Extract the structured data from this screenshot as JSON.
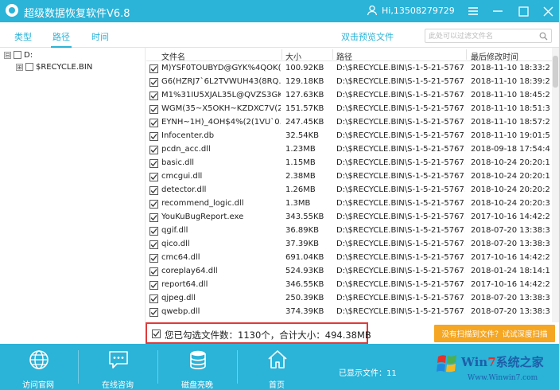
{
  "window": {
    "title": "超级数据恢复软件V6.8",
    "user": "Hi,13508279729",
    "accent_color": "#2bb3d8"
  },
  "toolbar": {
    "tabs": [
      {
        "label": "类型"
      },
      {
        "label": "路径"
      },
      {
        "label": "时间"
      }
    ],
    "active_tab": "路径",
    "preview_label": "双击预览文件",
    "search_placeholder": "此处可以过滤文件名"
  },
  "tree": {
    "items": [
      {
        "toggle": "⊟",
        "label": "D:"
      },
      {
        "toggle": "⊞",
        "label": "$RECYCLE.BIN"
      }
    ]
  },
  "table": {
    "columns": [
      "文件名",
      "大小",
      "路径",
      "最后修改时间"
    ],
    "rows": [
      {
        "name": "M)YSF0TOUBYD@GYK%4QOK(...",
        "size": "100.92KB",
        "path": "D:\\$RECYCLE.BIN\\S-1-5-21-5767...",
        "time": "2018-11-10 18:33:22"
      },
      {
        "name": "G6(HZRJ7`6L2TVWUH43(8RQ.j...",
        "size": "129.18KB",
        "path": "D:\\$RECYCLE.BIN\\S-1-5-21-5767...",
        "time": "2018-11-10 18:39:22"
      },
      {
        "name": "M1%31IU5XJAL35L@QVZS3GK...",
        "size": "127.63KB",
        "path": "D:\\$RECYCLE.BIN\\S-1-5-21-5767...",
        "time": "2018-11-10 18:45:22"
      },
      {
        "name": "WGM(35~X5OKH~KZDXC7V(2...",
        "size": "151.57KB",
        "path": "D:\\$RECYCLE.BIN\\S-1-5-21-5767...",
        "time": "2018-11-10 18:51:31"
      },
      {
        "name": "EYNH~1H)_4OH$4%(2(1VU`0.j...",
        "size": "247.45KB",
        "path": "D:\\$RECYCLE.BIN\\S-1-5-21-5767...",
        "time": "2018-11-10 18:57:23"
      },
      {
        "name": "Infocenter.db",
        "size": "32.54KB",
        "path": "D:\\$RECYCLE.BIN\\S-1-5-21-5767...",
        "time": "2018-11-10 19:01:56"
      },
      {
        "name": "pcdn_acc.dll",
        "size": "1.23MB",
        "path": "D:\\$RECYCLE.BIN\\S-1-5-21-5767...",
        "time": "2018-09-18 17:54:46"
      },
      {
        "name": "basic.dll",
        "size": "1.15MB",
        "path": "D:\\$RECYCLE.BIN\\S-1-5-21-5767...",
        "time": "2018-10-24 20:20:10"
      },
      {
        "name": "cmcgui.dll",
        "size": "2.38MB",
        "path": "D:\\$RECYCLE.BIN\\S-1-5-21-5767...",
        "time": "2018-10-24 20:20:18"
      },
      {
        "name": "detector.dll",
        "size": "1.26MB",
        "path": "D:\\$RECYCLE.BIN\\S-1-5-21-5767...",
        "time": "2018-10-24 20:20:28"
      },
      {
        "name": "recommend_logic.dll",
        "size": "1.3MB",
        "path": "D:\\$RECYCLE.BIN\\S-1-5-21-5767...",
        "time": "2018-10-24 20:20:30"
      },
      {
        "name": "YouKuBugReport.exe",
        "size": "343.55KB",
        "path": "D:\\$RECYCLE.BIN\\S-1-5-21-5767...",
        "time": "2017-10-16 14:42:28"
      },
      {
        "name": "qgif.dll",
        "size": "36.89KB",
        "path": "D:\\$RECYCLE.BIN\\S-1-5-21-5767...",
        "time": "2018-07-20 13:38:30"
      },
      {
        "name": "qico.dll",
        "size": "37.39KB",
        "path": "D:\\$RECYCLE.BIN\\S-1-5-21-5767...",
        "time": "2018-07-20 13:38:30"
      },
      {
        "name": "cmc64.dll",
        "size": "691.04KB",
        "path": "D:\\$RECYCLE.BIN\\S-1-5-21-5767...",
        "time": "2017-10-16 14:42:28"
      },
      {
        "name": "coreplay64.dll",
        "size": "524.93KB",
        "path": "D:\\$RECYCLE.BIN\\S-1-5-21-5767...",
        "time": "2018-01-24 18:14:12"
      },
      {
        "name": "report64.dll",
        "size": "346.55KB",
        "path": "D:\\$RECYCLE.BIN\\S-1-5-21-5767...",
        "time": "2017-10-16 14:42:28"
      },
      {
        "name": "qjpeg.dll",
        "size": "250.39KB",
        "path": "D:\\$RECYCLE.BIN\\S-1-5-21-5767...",
        "time": "2018-07-20 13:38:30"
      },
      {
        "name": "qwebp.dll",
        "size": "374.39KB",
        "path": "D:\\$RECYCLE.BIN\\S-1-5-21-5767...",
        "time": "2018-07-20 13:38:30"
      }
    ]
  },
  "summary": {
    "text": "您已勾选文件数：1130个，合计大小：494.38MB"
  },
  "deep_scan": {
    "label": "没有扫描到文件？试试深度扫描"
  },
  "bottom_nav": {
    "items": [
      {
        "label": "访问官网",
        "icon": "globe-icon"
      },
      {
        "label": "在线咨询",
        "icon": "chat-icon"
      },
      {
        "label": "磁盘亮晚",
        "icon": "database-icon"
      },
      {
        "label": "首页",
        "icon": "home-icon"
      }
    ],
    "shown_files": "已显示文件：11"
  },
  "watermark": {
    "text_prefix": "Win",
    "text_seven": "7",
    "text_suffix": "系统之家",
    "url": "Www.Winwin7.com"
  }
}
